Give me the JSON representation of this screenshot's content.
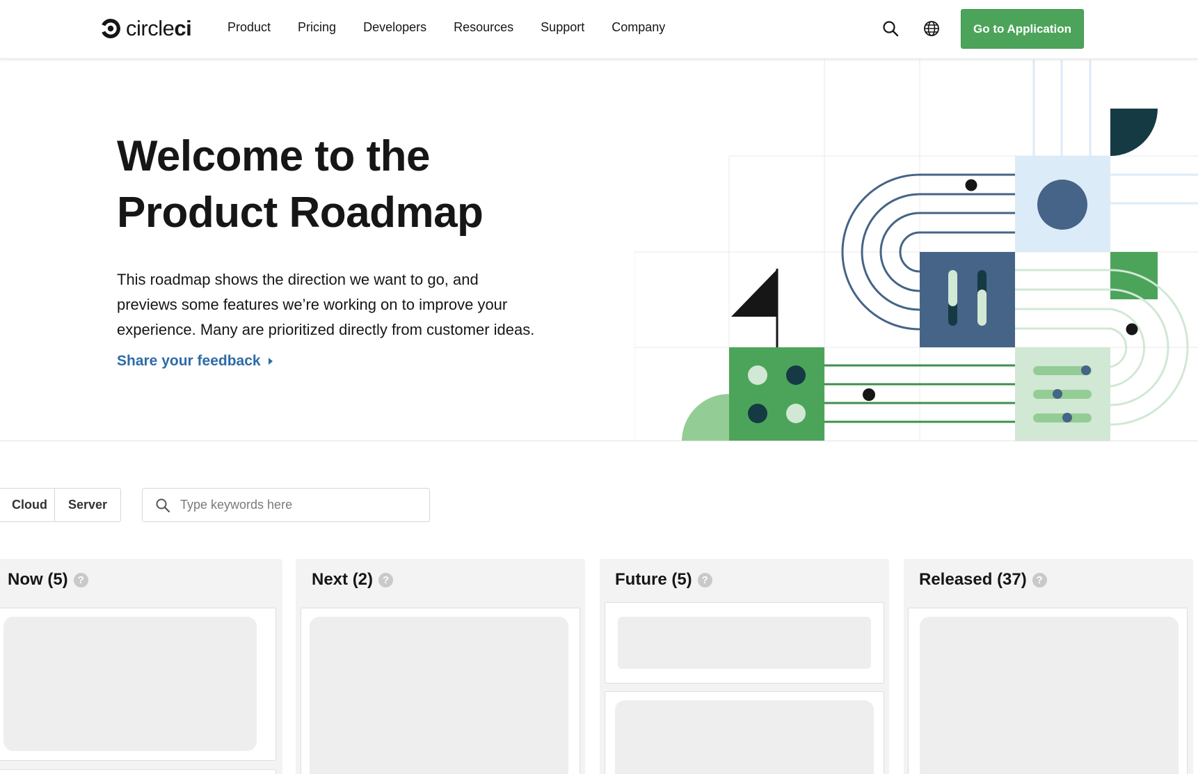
{
  "header": {
    "logo_text_plain": "circle",
    "logo_text_bold": "ci",
    "nav": [
      "Product",
      "Pricing",
      "Developers",
      "Resources",
      "Support",
      "Company"
    ],
    "cta_label": "Go to Application",
    "icons": [
      "search-icon",
      "globe-icon"
    ]
  },
  "hero": {
    "title_lines": [
      "Welcome to the",
      "Product Roadmap"
    ],
    "body_lines": [
      "This roadmap shows the direction we want to go, and",
      "previews some features we’re working on to improve your",
      "experience. Many are prioritized directly from customer ideas."
    ],
    "feedback_link": "Share your feedback"
  },
  "filters": {
    "segments": [
      "Cloud",
      "Server"
    ],
    "search_placeholder": "Type keywords here"
  },
  "columns": [
    {
      "title": "Now (5)"
    },
    {
      "title": "Next (2)"
    },
    {
      "title": "Future (5)"
    },
    {
      "title": "Released (37)"
    }
  ],
  "colors": {
    "brand_green": "#4ca45a",
    "link_blue": "#2d6ba7",
    "slate_blue": "#456487",
    "dark_teal": "#163a44",
    "light_green": "#94cc96",
    "pale_green": "#d1e8d4",
    "pale_blue": "#dcebf8"
  }
}
